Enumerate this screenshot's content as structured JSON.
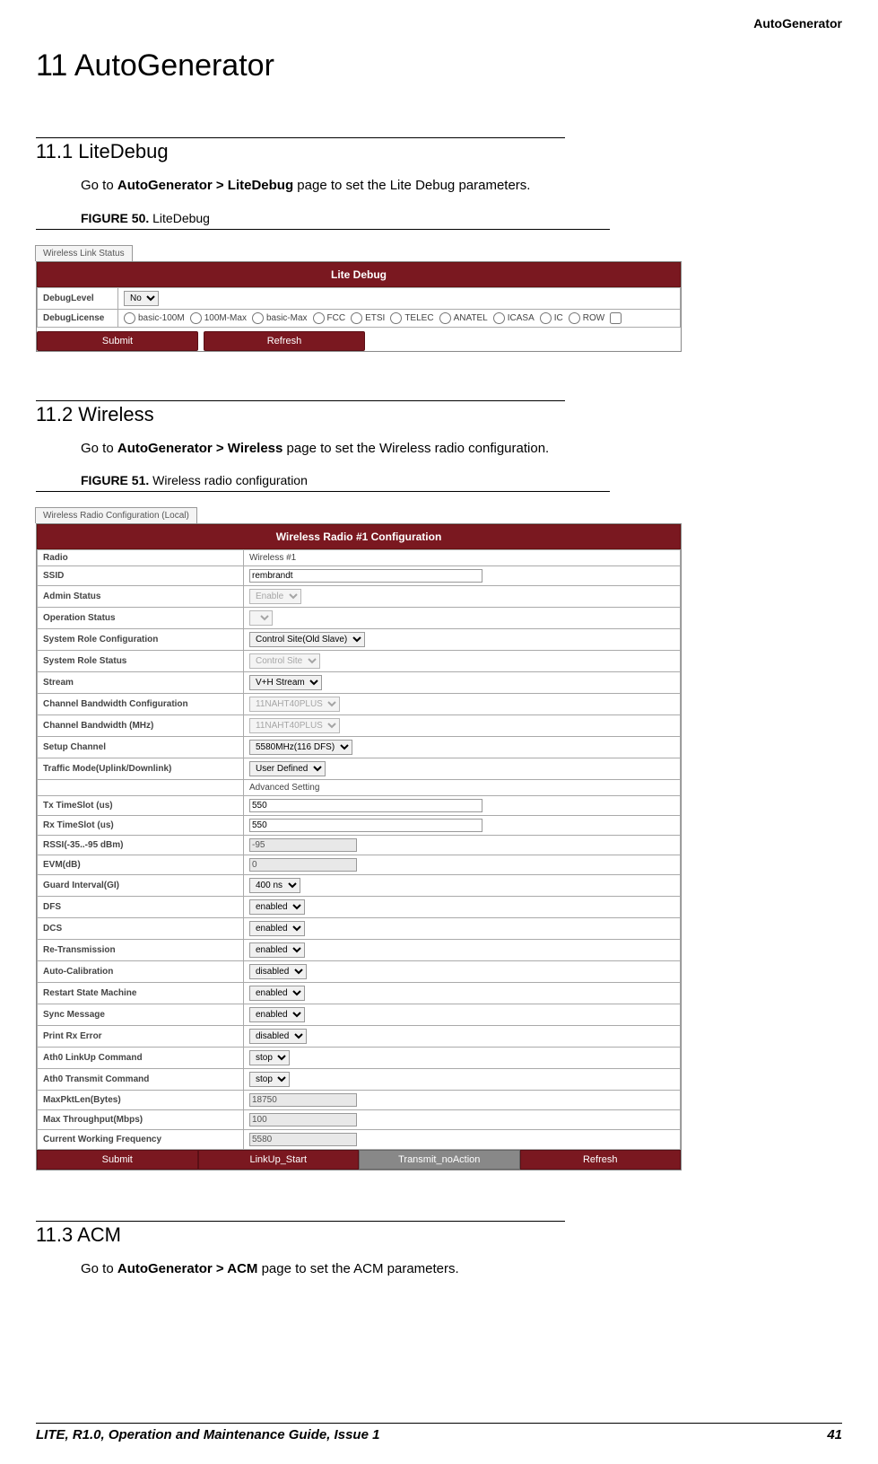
{
  "running_head": "AutoGenerator",
  "chapter_title": "11 AutoGenerator",
  "section_11_1": {
    "heading": "11.1 LiteDebug",
    "body_pre": "Go to ",
    "body_bold": "AutoGenerator > LiteDebug",
    "body_post": " page to set the Lite Debug parameters.",
    "fig_label": "FIGURE 50.",
    "fig_title": " LiteDebug"
  },
  "fig50": {
    "tab": "Wireless Link Status",
    "header": "Lite Debug",
    "row1_label": "DebugLevel",
    "row1_select": "No",
    "row2_label": "DebugLicense",
    "licenses": [
      "basic-100M",
      "100M-Max",
      "basic-Max",
      "FCC",
      "ETSI",
      "TELEC",
      "ANATEL",
      "ICASA",
      "IC",
      "ROW"
    ],
    "btn_submit": "Submit",
    "btn_refresh": "Refresh"
  },
  "section_11_2": {
    "heading": "11.2 Wireless",
    "body_pre": "Go to ",
    "body_bold": "AutoGenerator > Wireless",
    "body_post": " page to set the Wireless radio configuration.",
    "fig_label": "FIGURE 51.",
    "fig_title": " Wireless radio configuration"
  },
  "fig51": {
    "tab": "Wireless Radio Configuration (Local)",
    "header": "Wireless Radio #1 Configuration",
    "rows": [
      {
        "label": "Radio",
        "type": "static",
        "value": "Wireless #1"
      },
      {
        "label": "SSID",
        "type": "text",
        "value": "rembrandt"
      },
      {
        "label": "Admin Status",
        "type": "select_ro",
        "value": "Enable"
      },
      {
        "label": "Operation Status",
        "type": "select_ro",
        "value": ""
      },
      {
        "label": "System Role Configuration",
        "type": "select",
        "value": "Control Site(Old Slave)"
      },
      {
        "label": "System Role Status",
        "type": "select_ro",
        "value": "Control Site"
      },
      {
        "label": "Stream",
        "type": "select",
        "value": "V+H Stream"
      },
      {
        "label": "Channel Bandwidth Configuration",
        "type": "select_ro",
        "value": "11NAHT40PLUS"
      },
      {
        "label": "Channel Bandwidth (MHz)",
        "type": "select_ro",
        "value": "11NAHT40PLUS"
      },
      {
        "label": "Setup Channel",
        "type": "select",
        "value": "5580MHz(116 DFS)"
      },
      {
        "label": "Traffic Mode(Uplink/Downlink)",
        "type": "select",
        "value": "User Defined"
      },
      {
        "label": "",
        "type": "advanced",
        "value": "Advanced Setting"
      },
      {
        "label": "Tx TimeSlot (us)",
        "type": "text",
        "value": "550"
      },
      {
        "label": "Rx TimeSlot (us)",
        "type": "text",
        "value": "550"
      },
      {
        "label": "RSSI(-35..-95 dBm)",
        "type": "text_ro",
        "value": "-95"
      },
      {
        "label": "EVM(dB)",
        "type": "text_ro",
        "value": "0"
      },
      {
        "label": "Guard Interval(GI)",
        "type": "select",
        "value": "400 ns"
      },
      {
        "label": "DFS",
        "type": "select",
        "value": "enabled"
      },
      {
        "label": "DCS",
        "type": "select",
        "value": "enabled"
      },
      {
        "label": "Re-Transmission",
        "type": "select",
        "value": "enabled"
      },
      {
        "label": "Auto-Calibration",
        "type": "select",
        "value": "disabled"
      },
      {
        "label": "Restart State Machine",
        "type": "select",
        "value": "enabled"
      },
      {
        "label": "Sync Message",
        "type": "select",
        "value": "enabled"
      },
      {
        "label": "Print Rx Error",
        "type": "select",
        "value": "disabled"
      },
      {
        "label": "Ath0 LinkUp Command",
        "type": "select",
        "value": "stop"
      },
      {
        "label": "Ath0 Transmit Command",
        "type": "select",
        "value": "stop"
      },
      {
        "label": "MaxPktLen(Bytes)",
        "type": "text_ro",
        "value": "18750"
      },
      {
        "label": "Max Throughput(Mbps)",
        "type": "text_ro",
        "value": "100"
      },
      {
        "label": "Current Working Frequency",
        "type": "text_ro",
        "value": "5580"
      }
    ],
    "btn_submit": "Submit",
    "btn_linkup": "LinkUp_Start",
    "btn_transmit": "Transmit_noAction",
    "btn_refresh": "Refresh"
  },
  "section_11_3": {
    "heading": "11.3 ACM",
    "body_pre": "Go to ",
    "body_bold": "AutoGenerator > ACM",
    "body_post": " page to set the ACM parameters."
  },
  "footer": {
    "left": "LITE, R1.0, Operation and Maintenance Guide, Issue 1",
    "right": "41"
  }
}
